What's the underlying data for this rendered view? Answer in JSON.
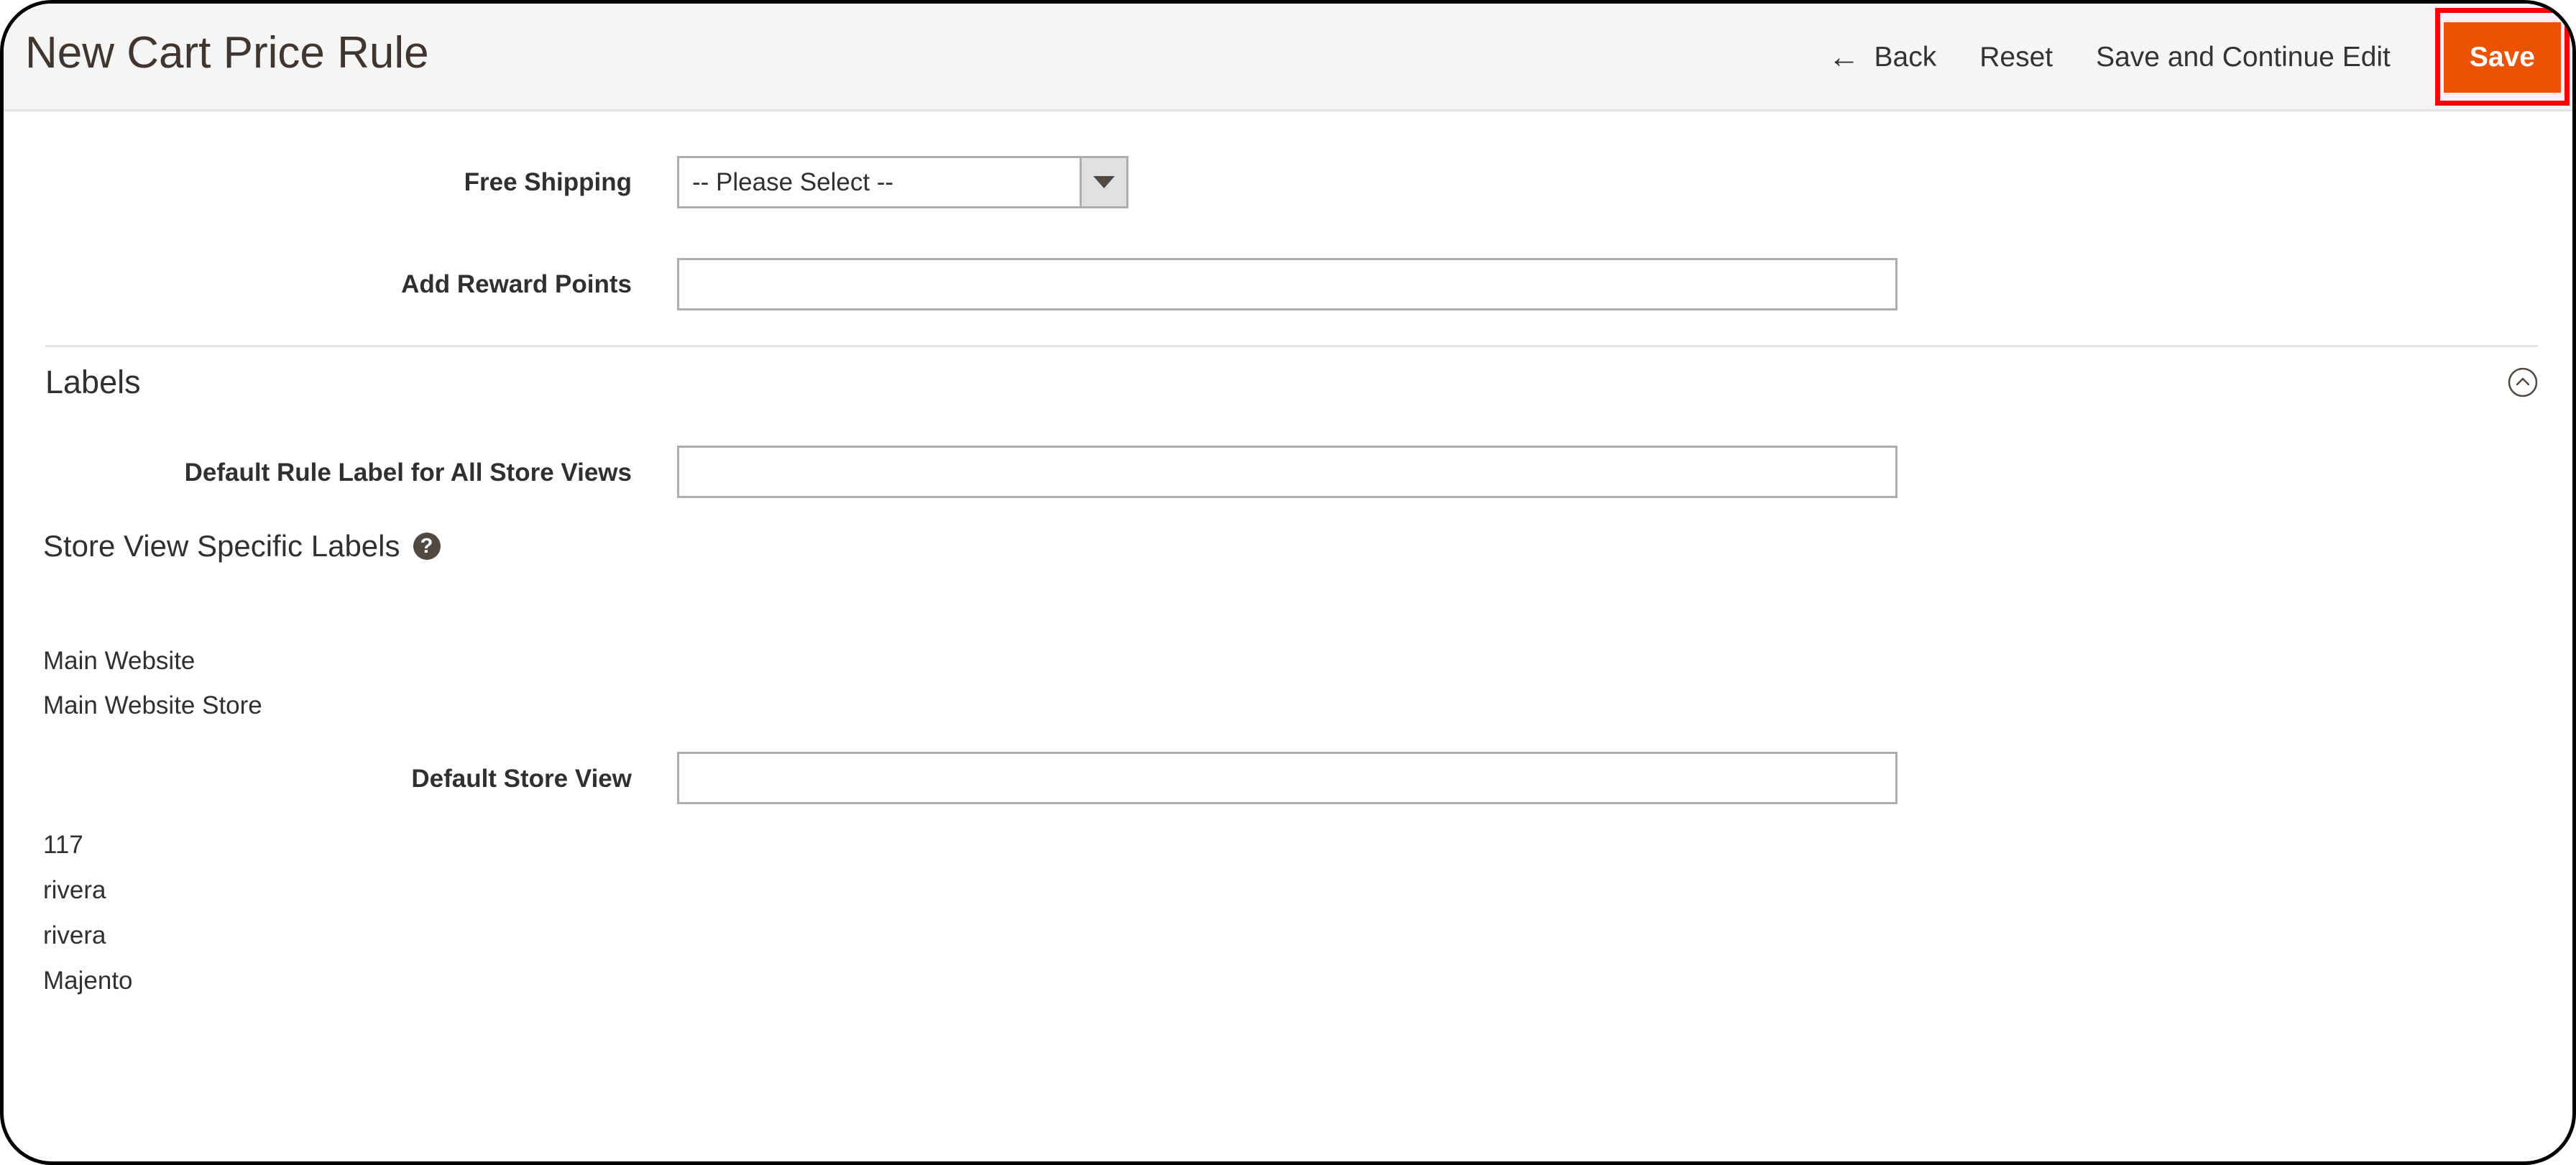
{
  "header": {
    "title": "New Cart Price Rule",
    "back_label": "Back",
    "back_icon": "arrow-left-icon",
    "reset_label": "Reset",
    "save_continue_label": "Save and Continue Edit",
    "save_label": "Save",
    "save_button_color": "#eb5202",
    "highlight_color": "#fb0007"
  },
  "form": {
    "free_shipping": {
      "label": "Free Shipping",
      "value": "-- Please Select --",
      "arrow_icon": "chevron-down-icon"
    },
    "add_reward_points": {
      "label": "Add Reward Points",
      "value": "",
      "placeholder": ""
    }
  },
  "labels_section": {
    "title": "Labels",
    "collapse_icon": "chevron-up-circle-icon",
    "default_rule_label": {
      "label": "Default Rule Label for All Store Views",
      "value": "",
      "placeholder": ""
    },
    "store_view_specific": {
      "title": "Store View Specific Labels",
      "help_icon": "question-mark-icon",
      "website": "Main Website",
      "store": "Main Website Store",
      "default_store_view": {
        "label": "Default Store View",
        "value": "",
        "placeholder": ""
      },
      "extra_items": [
        "117",
        "rivera",
        "rivera",
        "Majento"
      ]
    }
  }
}
